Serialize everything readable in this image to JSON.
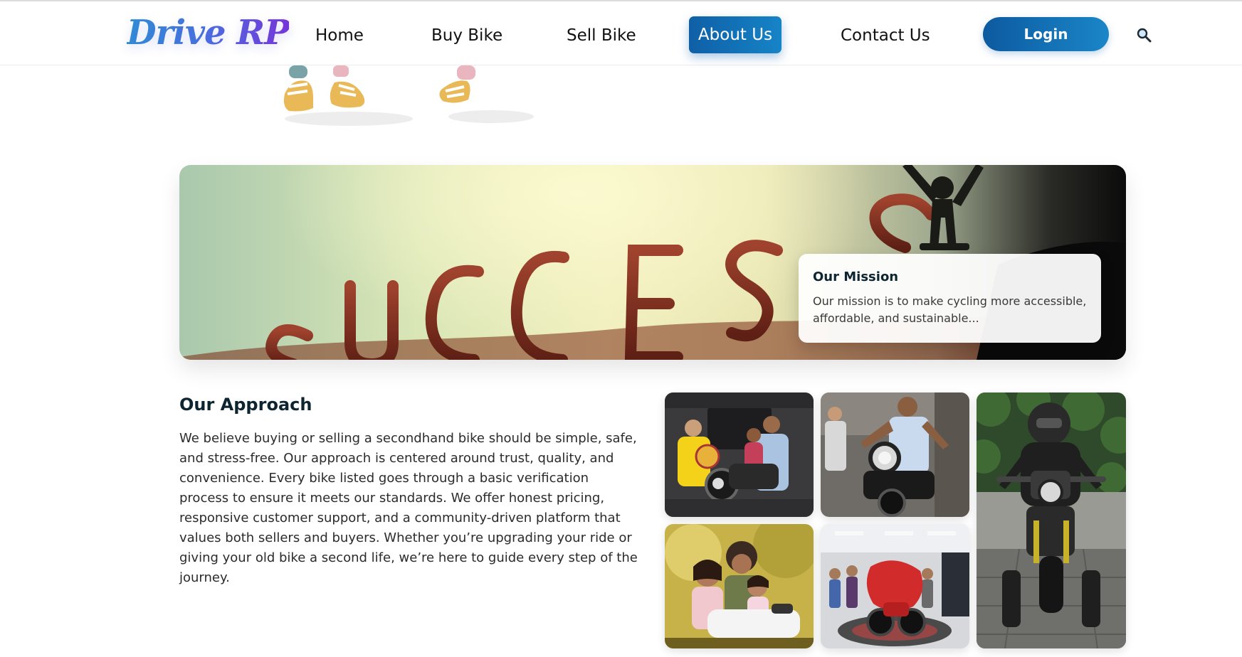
{
  "brand": {
    "logo_text": "Drive RP"
  },
  "nav": {
    "items": [
      {
        "label": "Home"
      },
      {
        "label": "Buy Bike"
      },
      {
        "label": "Sell Bike"
      },
      {
        "label": "About Us",
        "active": true
      },
      {
        "label": "Contact Us"
      }
    ],
    "login_label": "Login",
    "search_icon": "search-icon"
  },
  "banner": {
    "image_text": "SUCCESS",
    "mission": {
      "title": "Our Mission",
      "text": "Our mission is to make cycling more accessible, affordable, and sustainable..."
    }
  },
  "approach": {
    "title": "Our Approach",
    "text": "We believe buying or selling a secondhand bike should be simple, safe, and stress-free. Our approach is centered around trust, quality, and convenience. Every bike listed goes through a basic verification process to ensure it meets our standards. We offer honest pricing, responsive customer support, and a community-driven platform that values both sellers and buyers. Whether you’re upgrading your ride or giving your old bike a second life, we’re here to guide every step of the journey."
  },
  "colors": {
    "primary_gradient_start": "#0d5aa0",
    "primary_gradient_end": "#1a86c8",
    "heading": "#0d2530"
  }
}
